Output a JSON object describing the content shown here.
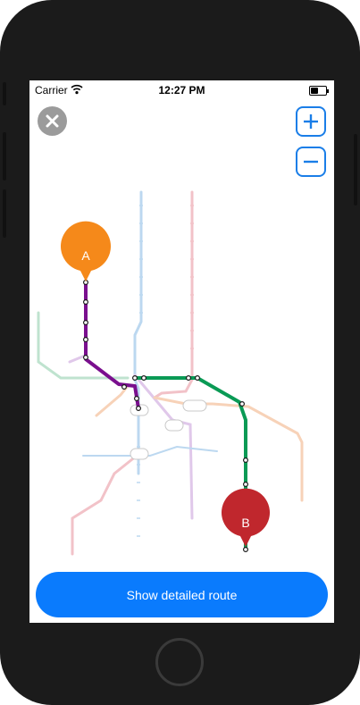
{
  "status_bar": {
    "carrier": "Carrier",
    "time": "12:27 PM"
  },
  "controls": {
    "close_icon": "close-icon",
    "zoom_in_icon": "plus-icon",
    "zoom_out_icon": "minus-icon"
  },
  "map": {
    "marker_a": "A",
    "marker_b": "B",
    "colors": {
      "route_purple": "#7a0f8e",
      "route_green": "#0a9a55",
      "marker_a": "#f5891a",
      "marker_b": "#c0272d",
      "faded_blue": "#bcd8f0",
      "faded_pink": "#f2c2c8",
      "faded_green": "#bfe3cf",
      "faded_orange": "#f7d2b8",
      "faded_purple": "#e0c8ea"
    }
  },
  "cta": {
    "label": "Show detailed route"
  },
  "colors": {
    "accent": "#0a7bfd"
  }
}
